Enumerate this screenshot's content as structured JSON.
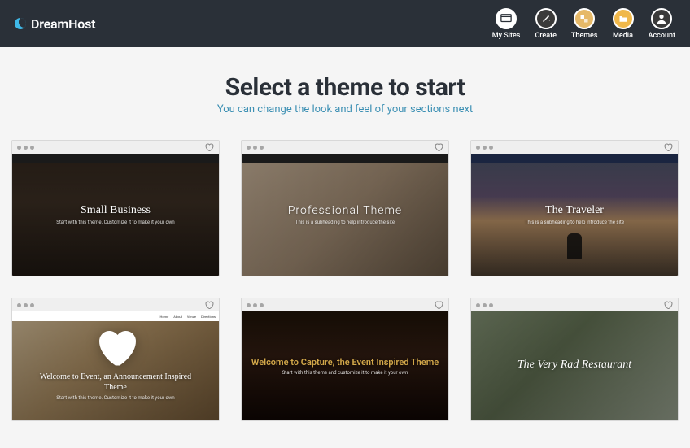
{
  "brand": "DreamHost",
  "nav": [
    {
      "label": "My Sites",
      "icon": "sites-icon"
    },
    {
      "label": "Create",
      "icon": "wand-icon"
    },
    {
      "label": "Themes",
      "icon": "themes-icon"
    },
    {
      "label": "Media",
      "icon": "folder-icon"
    },
    {
      "label": "Account",
      "icon": "account-icon"
    }
  ],
  "hero": {
    "title": "Select a theme to start",
    "subtitle": "You can change the look and feel of your sections next"
  },
  "themes": [
    {
      "title": "Small Business",
      "subtitle": "Start with this theme. Customize it to make it your own"
    },
    {
      "title": "Professional Theme",
      "subtitle": "This is a subheading to help introduce the site"
    },
    {
      "title": "The Traveler",
      "subtitle": "This is a subheading to help introduce the site"
    },
    {
      "title": "Welcome to Event, an Announcement Inspired Theme",
      "subtitle": "Start with this theme. Customize it to make it your own"
    },
    {
      "title": "Welcome to Capture, the Event Inspired Theme",
      "subtitle": "Start with this theme and customize it to make it your own"
    },
    {
      "title": "The Very Rad Restaurant",
      "subtitle": ""
    }
  ],
  "eventNav": [
    "Home",
    "About",
    "Venue",
    "Directions"
  ]
}
